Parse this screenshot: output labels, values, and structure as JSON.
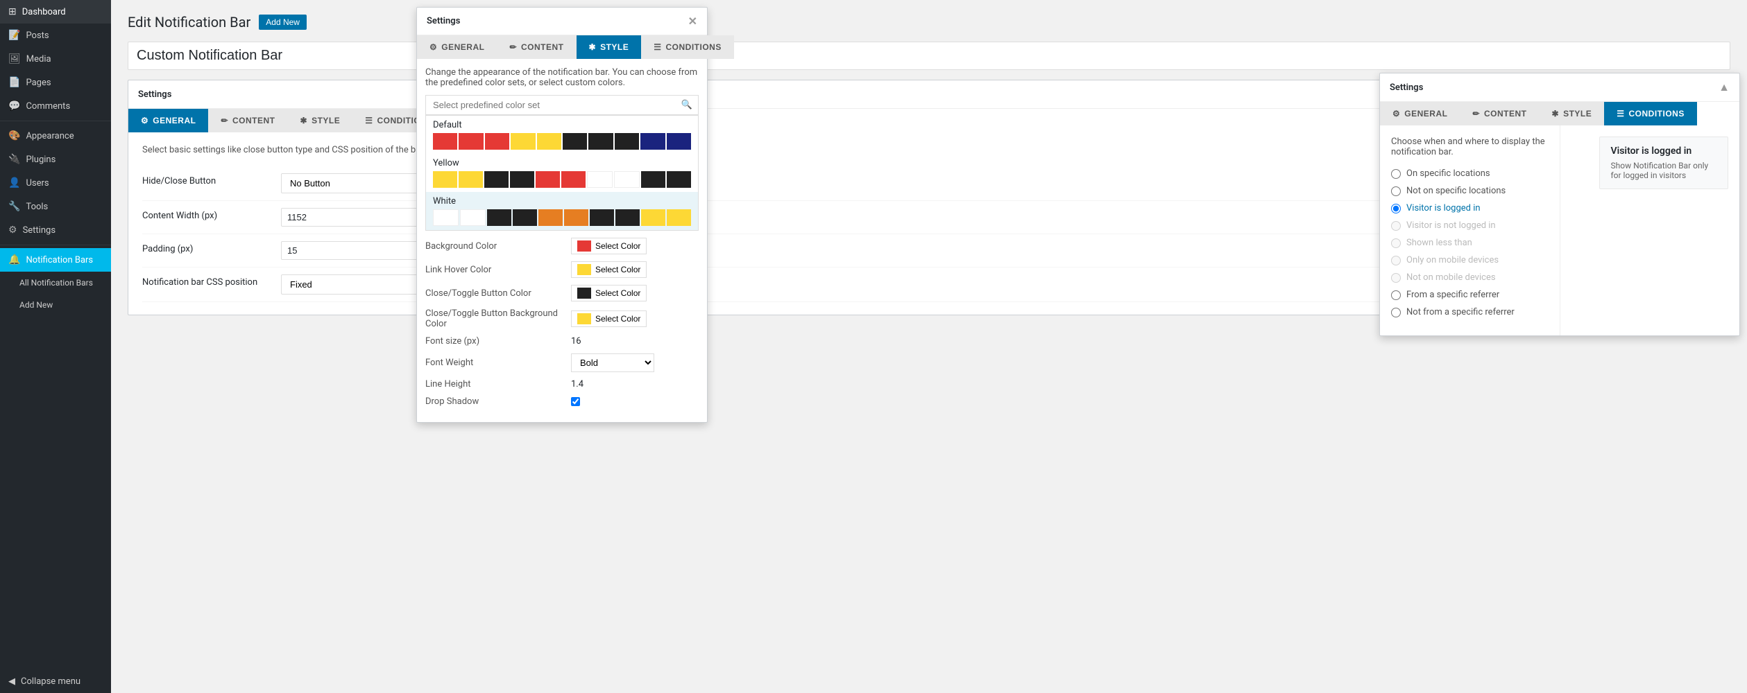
{
  "sidebar": {
    "items": [
      {
        "id": "dashboard",
        "label": "Dashboard",
        "icon": "⊞"
      },
      {
        "id": "posts",
        "label": "Posts",
        "icon": "📝"
      },
      {
        "id": "media",
        "label": "Media",
        "icon": "🖼"
      },
      {
        "id": "pages",
        "label": "Pages",
        "icon": "📄"
      },
      {
        "id": "comments",
        "label": "Comments",
        "icon": "💬"
      },
      {
        "id": "appearance",
        "label": "Appearance",
        "icon": "🎨"
      },
      {
        "id": "plugins",
        "label": "Plugins",
        "icon": "🔌"
      },
      {
        "id": "users",
        "label": "Users",
        "icon": "👤"
      },
      {
        "id": "tools",
        "label": "Tools",
        "icon": "🔧"
      },
      {
        "id": "settings",
        "label": "Settings",
        "icon": "⚙"
      }
    ],
    "notification_bars_label": "Notification Bars",
    "all_notification_bars_label": "All Notification Bars",
    "add_new_label": "Add New",
    "collapse_menu_label": "Collapse menu"
  },
  "page": {
    "title": "Edit Notification Bar",
    "add_new_label": "Add New",
    "bar_title_value": "Custom Notification Bar"
  },
  "settings_panel": {
    "title": "Settings",
    "close_icon": "▲",
    "tabs": [
      {
        "id": "general",
        "label": "GENERAL",
        "icon": "⚙",
        "active": true
      },
      {
        "id": "content",
        "label": "CONTENT",
        "icon": "✏"
      },
      {
        "id": "style",
        "label": "STYLE",
        "icon": "✱"
      },
      {
        "id": "conditions",
        "label": "CONDITIONS",
        "icon": "☰"
      }
    ],
    "description": "Select basic settings like close button type and CSS position of the bar.",
    "fields": [
      {
        "id": "hide_close_button",
        "label": "Hide/Close Button",
        "type": "select",
        "value": "No Button"
      },
      {
        "id": "content_width",
        "label": "Content Width (px)",
        "type": "text",
        "value": "1152"
      },
      {
        "id": "padding",
        "label": "Padding (px)",
        "type": "text",
        "value": "15"
      },
      {
        "id": "css_position",
        "label": "Notification bar CSS position",
        "type": "select",
        "value": "Fixed"
      }
    ]
  },
  "style_panel": {
    "title": "Settings",
    "close_icon": "✕",
    "tabs": [
      {
        "id": "general",
        "label": "GENERAL",
        "icon": "⚙"
      },
      {
        "id": "content",
        "label": "CONTENT",
        "icon": "✏"
      },
      {
        "id": "style",
        "label": "STYLE",
        "icon": "✱",
        "active": true
      },
      {
        "id": "conditions",
        "label": "CONDITIONS",
        "icon": "☰"
      }
    ],
    "description": "Change the appearance of the notification bar. You can choose from the predefined color sets, or select custom colors.",
    "color_set_placeholder": "Select predefined color set",
    "color_sets": [
      {
        "id": "default",
        "label": "Default",
        "swatches": [
          "#e53935",
          "#e53935",
          "#e53935",
          "#fdd835",
          "#fdd835",
          "#fdd835",
          "#212121",
          "#212121",
          "#212121",
          "#1a237e",
          "#1a237e",
          "#1a237e",
          "#1a237e"
        ]
      },
      {
        "id": "yellow",
        "label": "Yellow",
        "swatches": [
          "#fdd835",
          "#fdd835",
          "#fdd835",
          "#212121",
          "#212121",
          "#212121",
          "#e53935",
          "#e53935",
          "#e53935",
          "#fff",
          "#fff",
          "#fff",
          "#212121"
        ]
      },
      {
        "id": "white",
        "label": "White",
        "swatches": [
          "#fff",
          "#fff",
          "#212121",
          "#212121",
          "#e67e22",
          "#e67e22",
          "#212121",
          "#212121",
          "#212121",
          "#e67e22",
          "#e67e22",
          "#212121",
          "#fdd835"
        ]
      }
    ],
    "color_fields": [
      {
        "id": "bg_color",
        "label": "Background Color",
        "color": "#e53935"
      },
      {
        "id": "link_hover_color",
        "label": "Link Hover Color",
        "color": "#fdd835"
      },
      {
        "id": "close_toggle_btn_color",
        "label": "Close/Toggle Button Color",
        "color": "#212121"
      },
      {
        "id": "close_toggle_bg_color",
        "label": "Close/Toggle Button Background Color",
        "color": "#fdd835"
      }
    ],
    "font_fields": [
      {
        "id": "font_size",
        "label": "Font size (px)",
        "value": "16",
        "type": "text"
      },
      {
        "id": "font_weight",
        "label": "Font Weight",
        "value": "Bold",
        "type": "select"
      },
      {
        "id": "line_height",
        "label": "Line Height",
        "value": "1.4",
        "type": "text"
      }
    ],
    "drop_shadow_label": "Drop Shadow",
    "drop_shadow_checked": true,
    "select_color_label": "Select Color"
  },
  "conditions_panel": {
    "title": "Settings",
    "close_icon": "▲",
    "tabs": [
      {
        "id": "general",
        "label": "GENERAL",
        "icon": "⚙"
      },
      {
        "id": "content",
        "label": "CONTENT",
        "icon": "✏"
      },
      {
        "id": "style",
        "label": "STYLE",
        "icon": "✱"
      },
      {
        "id": "conditions",
        "label": "CONDITIONS",
        "icon": "☰",
        "active": true
      }
    ],
    "description": "Choose when and where to display the notification bar.",
    "conditions": [
      {
        "id": "specific_locations",
        "label": "On specific locations",
        "active": false,
        "disabled": false
      },
      {
        "id": "not_specific_locations",
        "label": "Not on specific locations",
        "active": false,
        "disabled": false
      },
      {
        "id": "visitor_logged_in",
        "label": "Visitor is logged in",
        "active": true,
        "disabled": false
      },
      {
        "id": "visitor_not_logged_in",
        "label": "Visitor is not logged in",
        "active": false,
        "disabled": true
      },
      {
        "id": "shown_less_than",
        "label": "Shown less than",
        "active": false,
        "disabled": true
      },
      {
        "id": "only_mobile",
        "label": "Only on mobile devices",
        "active": false,
        "disabled": true
      },
      {
        "id": "not_mobile",
        "label": "Not on mobile devices",
        "active": false,
        "disabled": true
      },
      {
        "id": "specific_referrer",
        "label": "From a specific referrer",
        "active": false,
        "disabled": false
      },
      {
        "id": "not_specific_referrer",
        "label": "Not from a specific referrer",
        "active": false,
        "disabled": false
      }
    ],
    "active_condition_title": "Visitor is logged in",
    "active_condition_desc": "Show Notification Bar only for logged in visitors"
  }
}
